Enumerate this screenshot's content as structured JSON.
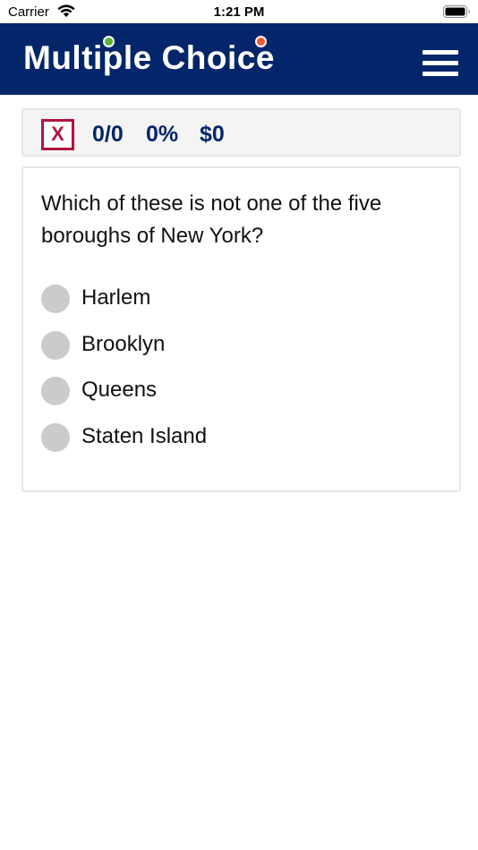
{
  "status_bar": {
    "carrier": "Carrier",
    "time": "1:21 PM",
    "icons": [
      "wifi-icon",
      "battery-icon"
    ]
  },
  "header": {
    "logo_text": "Multiple Choice",
    "logo_dot_colors": [
      "#5cb531",
      "#ee5a36"
    ],
    "menu_icon": "hamburger-menu-icon",
    "background_color": "#032569"
  },
  "score_bar": {
    "close_label": "X",
    "correct_count": "0/0",
    "percent": "0%",
    "money": "$0",
    "accent_color": "#b0153f",
    "stat_color": "#032569"
  },
  "question": {
    "text": "Which of these is not one of the five boroughs of New York?",
    "options": [
      {
        "label": "Harlem"
      },
      {
        "label": "Brooklyn"
      },
      {
        "label": "Queens"
      },
      {
        "label": "Staten Island"
      }
    ]
  }
}
